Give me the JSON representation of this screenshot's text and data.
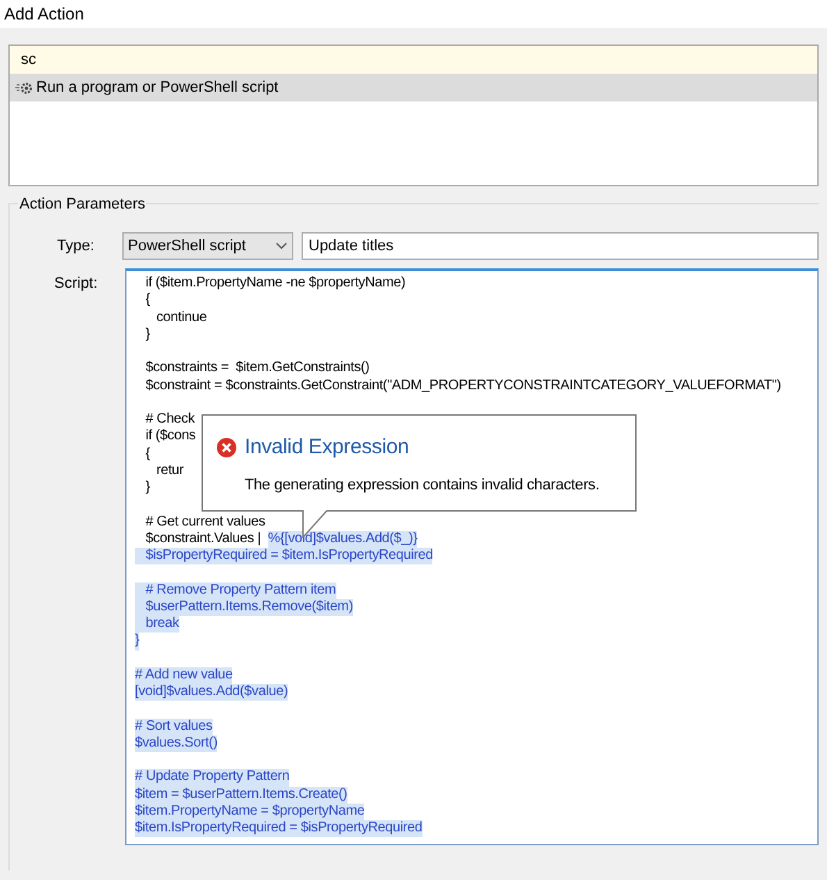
{
  "window": {
    "title": "Add Action"
  },
  "action_search": {
    "value": "sc",
    "items": [
      {
        "label": "Run a program or PowerShell script",
        "selected": true
      }
    ]
  },
  "parameters": {
    "title": "Action Parameters",
    "type_label": "Type:",
    "type_value": "PowerShell script",
    "name_value": "Update titles",
    "script_label": "Script:",
    "script": [
      [
        {
          "segments": [
            {
              "text": "   if ($item.PropertyName -ne $propertyName)",
              "selected": false
            }
          ]
        },
        {
          "segments": [
            {
              "text": "   {",
              "selected": false
            }
          ]
        },
        {
          "segments": [
            {
              "text": "      continue",
              "selected": false
            }
          ]
        },
        {
          "segments": [
            {
              "text": "   }",
              "selected": false
            }
          ]
        }
      ],
      [
        {
          "segments": [
            {
              "text": "   $constraints =  $item.GetConstraints()",
              "selected": false
            }
          ]
        },
        {
          "segments": [
            {
              "text": "   $constraint = $constraints.GetConstraint(\"ADM_PROPERTYCONSTRAINTCATEGORY_VALUEFORMAT\")",
              "selected": false
            }
          ]
        }
      ],
      [
        {
          "segments": [
            {
              "text": "   # Check",
              "selected": false
            }
          ]
        },
        {
          "segments": [
            {
              "text": "   if ($cons",
              "selected": false
            }
          ]
        },
        {
          "segments": [
            {
              "text": "   {",
              "selected": false
            }
          ]
        },
        {
          "segments": [
            {
              "text": "      retur",
              "selected": false
            }
          ]
        },
        {
          "segments": [
            {
              "text": "   }",
              "selected": false
            }
          ]
        }
      ],
      [
        {
          "segments": [
            {
              "text": "   # Get current values",
              "selected": false
            }
          ]
        },
        {
          "segments": [
            {
              "text": "   $constraint.Values |  ",
              "selected": false
            },
            {
              "text": "%{[void]$values.Add($_)}",
              "selected": true
            }
          ]
        },
        {
          "segments": [
            {
              "text": "   $isPropertyRequired = $item.IsPropertyRequired",
              "selected": true
            }
          ]
        }
      ],
      [
        {
          "segments": [
            {
              "text": "   # Remove Property Pattern item",
              "selected": true
            }
          ]
        },
        {
          "segments": [
            {
              "text": "   $userPattern.Items.Remove($item)",
              "selected": true
            }
          ]
        },
        {
          "segments": [
            {
              "text": "   break",
              "selected": true
            }
          ]
        },
        {
          "segments": [
            {
              "text": "}",
              "selected": true
            }
          ]
        }
      ],
      [
        {
          "segments": [
            {
              "text": "# Add new value",
              "selected": true
            }
          ]
        },
        {
          "segments": [
            {
              "text": "[void]$values.Add($value)",
              "selected": true
            }
          ]
        }
      ],
      [
        {
          "segments": [
            {
              "text": "# Sort values",
              "selected": true
            }
          ]
        },
        {
          "segments": [
            {
              "text": "$values.Sort()",
              "selected": true
            }
          ]
        }
      ],
      [
        {
          "segments": [
            {
              "text": "# Update Property Pattern",
              "selected": true
            }
          ]
        },
        {
          "segments": [
            {
              "text": "$item = $userPattern.Items.Create()",
              "selected": true
            }
          ]
        },
        {
          "segments": [
            {
              "text": "$item.PropertyName = $propertyName",
              "selected": true
            }
          ]
        },
        {
          "segments": [
            {
              "text": "$item.IsPropertyRequired = $isPropertyRequired",
              "selected": true
            }
          ]
        }
      ]
    ]
  },
  "error_tooltip": {
    "title": "Invalid Expression",
    "message": "The generating expression contains invalid characters."
  }
}
